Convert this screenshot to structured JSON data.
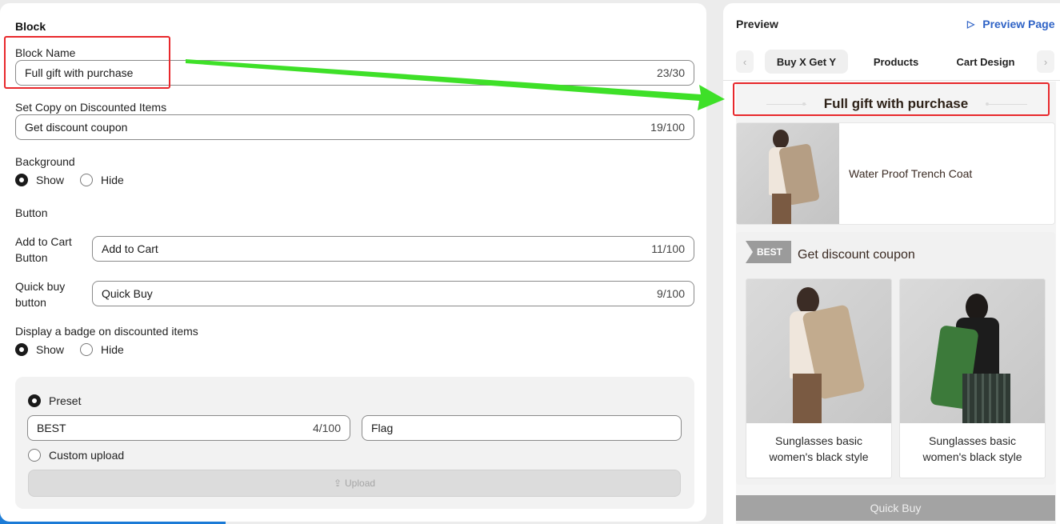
{
  "left": {
    "title": "Block",
    "block_name": {
      "label": "Block Name",
      "value": "Full gift with purchase",
      "count": "23/30"
    },
    "copy_discounted": {
      "label": "Set Copy on Discounted Items",
      "value": "Get discount coupon",
      "count": "19/100"
    },
    "background": {
      "label": "Background",
      "options": [
        "Show",
        "Hide"
      ],
      "selected": "Show"
    },
    "button_section": {
      "label": "Button"
    },
    "add_to_cart": {
      "label_line1": "Add to Cart",
      "label_line2": "Button",
      "value": "Add to Cart",
      "count": "11/100"
    },
    "quick_buy": {
      "label_line1": "Quick buy",
      "label_line2": "button",
      "value": "Quick Buy",
      "count": "9/100"
    },
    "badge": {
      "label": "Display a badge on discounted items",
      "options": [
        "Show",
        "Hide"
      ],
      "selected": "Show"
    },
    "badge_settings": {
      "preset_label": "Preset",
      "badge_text": "BEST",
      "badge_count": "4/100",
      "badge_style": "Flag",
      "custom_label": "Custom upload",
      "upload_label": "Upload"
    }
  },
  "right": {
    "title": "Preview",
    "preview_page": "Preview Page",
    "tabs": [
      "Buy X Get Y",
      "Products",
      "Cart Design"
    ],
    "active_tab": "Buy X Get Y",
    "heading": "Full gift with purchase",
    "product": {
      "name": "Water Proof Trench Coat"
    },
    "discount_block": {
      "badge": "BEST",
      "copy": "Get discount coupon",
      "cards": [
        {
          "name_line1": "Sunglasses basic",
          "name_line2": "women's black style"
        },
        {
          "name_line1": "Sunglasses basic",
          "name_line2": "women's black style"
        }
      ]
    },
    "quick_buy": "Quick Buy"
  },
  "colors": {
    "accent_blue": "#2f63c6",
    "highlight_red": "#e8282c",
    "arrow_green": "#3ee028"
  }
}
